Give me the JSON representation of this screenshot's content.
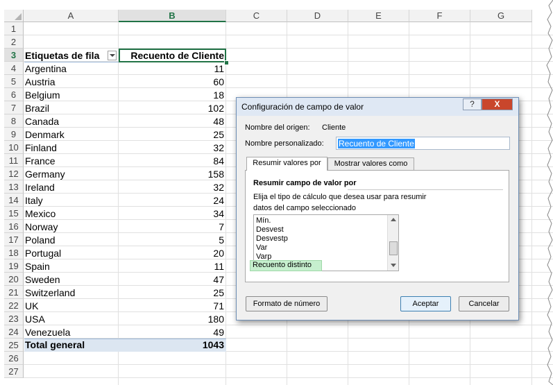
{
  "columns": [
    "A",
    "B",
    "C",
    "D",
    "E",
    "F",
    "G"
  ],
  "row_numbers": [
    "1",
    "2",
    "3",
    "4",
    "5",
    "6",
    "7",
    "8",
    "9",
    "10",
    "11",
    "12",
    "13",
    "14",
    "15",
    "16",
    "17",
    "18",
    "19",
    "20",
    "21",
    "22",
    "23",
    "24",
    "25",
    "26",
    "27"
  ],
  "pivot": {
    "header_row_label": "Etiquetas de fila",
    "header_value_label": "Recuento de Cliente",
    "rows": [
      {
        "country": "Argentina",
        "count": "11"
      },
      {
        "country": "Austria",
        "count": "60"
      },
      {
        "country": "Belgium",
        "count": "18"
      },
      {
        "country": "Brazil",
        "count": "102"
      },
      {
        "country": "Canada",
        "count": "48"
      },
      {
        "country": "Denmark",
        "count": "25"
      },
      {
        "country": "Finland",
        "count": "32"
      },
      {
        "country": "France",
        "count": "84"
      },
      {
        "country": "Germany",
        "count": "158"
      },
      {
        "country": "Ireland",
        "count": "32"
      },
      {
        "country": "Italy",
        "count": "24"
      },
      {
        "country": "Mexico",
        "count": "34"
      },
      {
        "country": "Norway",
        "count": "7"
      },
      {
        "country": "Poland",
        "count": "5"
      },
      {
        "country": "Portugal",
        "count": "20"
      },
      {
        "country": "Spain",
        "count": "11"
      },
      {
        "country": "Sweden",
        "count": "47"
      },
      {
        "country": "Switzerland",
        "count": "25"
      },
      {
        "country": "UK",
        "count": "71"
      },
      {
        "country": "USA",
        "count": "180"
      },
      {
        "country": "Venezuela",
        "count": "49"
      }
    ],
    "total_label": "Total general",
    "total_value": "1043"
  },
  "dialog": {
    "title": "Configuración de campo de valor",
    "help_button": "?",
    "close_button": "X",
    "source_name_label": "Nombre del origen:",
    "source_name_value": "Cliente",
    "custom_name_label": "Nombre personalizado:",
    "custom_name_value": "Recuento de Cliente",
    "tabs": [
      "Resumir valores por",
      "Mostrar valores como"
    ],
    "section_title": "Resumir campo de valor por",
    "description_line1": "Elija el tipo de cálculo que desea usar para resumir",
    "description_line2": "datos del campo seleccionado",
    "list_items": [
      "Mín.",
      "Desvest",
      "Desvestp",
      "Var",
      "Varp",
      "Recuento distinto"
    ],
    "selected_item": "Recuento distinto",
    "number_format_button": "Formato de número",
    "ok_button": "Aceptar",
    "cancel_button": "Cancelar"
  },
  "colors": {
    "excel_green": "#217346",
    "pivot_header_blue": "#dce6f1",
    "selection_highlight": "#3399ff",
    "list_selected_green": "#c6efce"
  }
}
